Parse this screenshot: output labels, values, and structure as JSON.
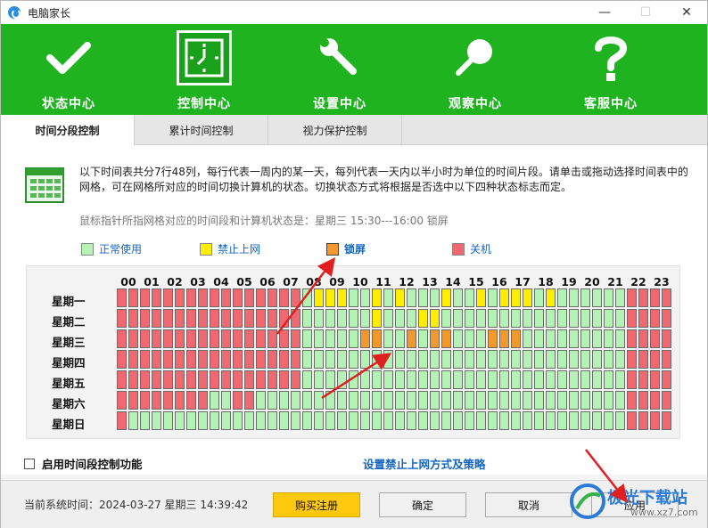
{
  "window": {
    "title": "电脑家长",
    "minimize": "—",
    "maximize": "☐",
    "close": "✕"
  },
  "nav": [
    {
      "label": "状态中心",
      "icon": "checkmark-icon",
      "active": false
    },
    {
      "label": "控制中心",
      "icon": "clock-icon",
      "active": true
    },
    {
      "label": "设置中心",
      "icon": "wrench-icon",
      "active": false
    },
    {
      "label": "观察中心",
      "icon": "magnifier-icon",
      "active": false
    },
    {
      "label": "客服中心",
      "icon": "question-icon",
      "active": false
    }
  ],
  "tabs": [
    {
      "label": "时间分段控制",
      "active": true
    },
    {
      "label": "累计时间控制",
      "active": false
    },
    {
      "label": "视力保护控制",
      "active": false
    }
  ],
  "description": "以下时间表共分7行48列，每行代表一周内的某一天，每列代表一天内以半小时为单位的时间片段。请单击或拖动选择时间表中的网格，可在网格所对应的时间切换计算机的状态。切换状态方式将根据是否选中以下四种状态标志而定。",
  "pointer_status": "鼠标指针所指网格对应的时间段和计算机状态是：星期三  15:30---16:00 锁屏",
  "legend": [
    {
      "key": "G",
      "label": "正常使用",
      "color": "#b5f2b5",
      "text_color": "#1565c0",
      "bold": false
    },
    {
      "key": "Y",
      "label": "禁止上网",
      "color": "#ffee00",
      "text_color": "#1565c0",
      "bold": false
    },
    {
      "key": "O",
      "label": "锁屏",
      "color": "#f2992e",
      "text_color": "#1565c0",
      "bold": true
    },
    {
      "key": "R",
      "label": "关机",
      "color": "#f06870",
      "text_color": "#1565c0",
      "bold": false
    }
  ],
  "hours": [
    "00",
    "01",
    "02",
    "03",
    "04",
    "05",
    "06",
    "07",
    "08",
    "09",
    "10",
    "11",
    "12",
    "13",
    "14",
    "15",
    "16",
    "17",
    "18",
    "19",
    "20",
    "21",
    "22",
    "23"
  ],
  "days": [
    "星期一",
    "星期二",
    "星期三",
    "星期四",
    "星期五",
    "星期六",
    "星期日"
  ],
  "schedule": [
    "RRRRRRRRRRRRRRRRGYYYGGYGYGGGYGGYGYYYGYGGGGGGRRRR",
    "RRRRRRRRRRRRRRRRGGGGGGYGGGYYGGGGGGGGGGGGGGGGRRRR",
    "RRRRRRRRRRRRRRRRGGGGGOOGGOGOOGGGOOOGGGGGGGGGRRRR",
    "RRRRRRRRRRRRRRRRGGGGGGGGGGGGGGGGGGGGGGGGGGGGRRRR",
    "RRRRRRRRRRRRRRRRGGGGGGGGGGGGGGGGGGGGGGGGGGGGRRRR",
    "RRRRRRRRGGRRGGGGGGGGGGGGGGGGGGGGGGGGGGGGGGGGRRRR",
    "RGGGGGGGGGGGGGGGGGGGGGGGGGGGGGGGGGGGGGGGGGGGRRRR"
  ],
  "enable_checkbox": {
    "label": "启用时间段控制功能",
    "checked": false
  },
  "policy_link": "设置禁止上网方式及策略",
  "footer": {
    "system_time": "当前系统时间：2024-03-27 星期三 14:39:42",
    "buy_button": "购买注册",
    "ok_button": "确定",
    "cancel_button": "取消",
    "apply_button": "应用"
  },
  "watermark": {
    "text": "极光下载站",
    "sub": "www.xz7.com"
  },
  "colors": {
    "nav_green": "#1fb31f",
    "link_blue": "#1565c0",
    "arrow_red": "#e02020"
  }
}
